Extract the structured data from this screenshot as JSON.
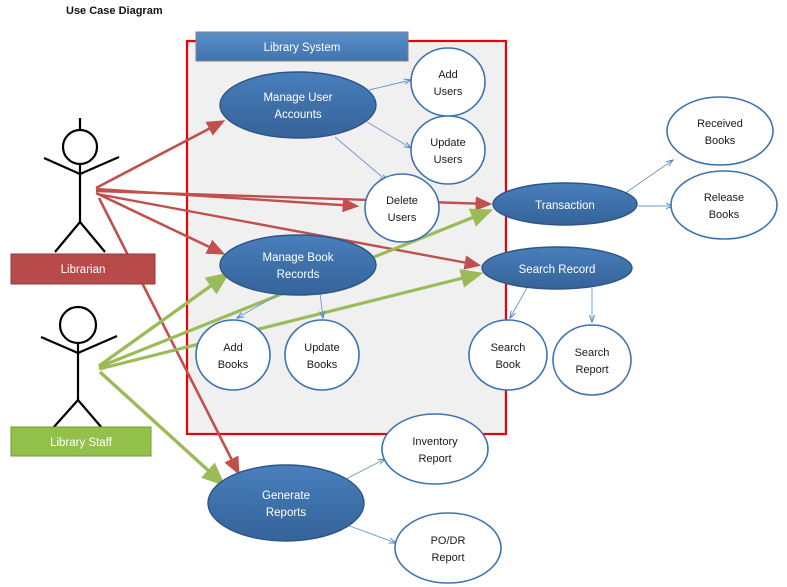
{
  "diagram": {
    "title": "Use Case Diagram",
    "type": "uml-use-case",
    "system_boundary": {
      "label": "Library System",
      "header_color": "#4a7ebb",
      "border_color": "#e8000b",
      "fill_color": "#f0f0f0"
    },
    "actors": [
      {
        "id": "librarian",
        "label": "Librarian",
        "color": "#b84a4a",
        "association_color": "#c0504d"
      },
      {
        "id": "library-staff",
        "label": "Library Staff",
        "color": "#92c04a",
        "association_color": "#9bbb59"
      }
    ],
    "primary_use_cases": [
      {
        "id": "manage-user-accounts",
        "line1": "Manage User",
        "line2": "Accounts"
      },
      {
        "id": "manage-book-records",
        "line1": "Manage Book",
        "line2": "Records"
      },
      {
        "id": "transaction",
        "line1": "Transaction",
        "line2": ""
      },
      {
        "id": "search-record",
        "line1": "Search Record",
        "line2": ""
      },
      {
        "id": "generate-reports",
        "line1": "Generate",
        "line2": "Reports"
      }
    ],
    "secondary_use_cases": [
      {
        "id": "add-users",
        "line1": "Add",
        "line2": "Users"
      },
      {
        "id": "update-users",
        "line1": "Update",
        "line2": "Users"
      },
      {
        "id": "delete-users",
        "line1": "Delete",
        "line2": "Users"
      },
      {
        "id": "add-books",
        "line1": "Add",
        "line2": "Books"
      },
      {
        "id": "update-books",
        "line1": "Update",
        "line2": "Books"
      },
      {
        "id": "received-books",
        "line1": "Received",
        "line2": "Books"
      },
      {
        "id": "release-books",
        "line1": "Release",
        "line2": "Books"
      },
      {
        "id": "search-book",
        "line1": "Search",
        "line2": "Book"
      },
      {
        "id": "search-report",
        "line1": "Search",
        "line2": "Report"
      },
      {
        "id": "inventory-report",
        "line1": "Inventory",
        "line2": "Report"
      },
      {
        "id": "po-dr-report",
        "line1": "PO/DR",
        "line2": "Report"
      }
    ],
    "colors": {
      "ellipse_fill": "#3f72ad",
      "ellipse_stroke": "#2d5586",
      "circle_fill": "#ffffff",
      "circle_stroke": "#3f72ad",
      "include_arrow": "#4a7ebb"
    }
  }
}
